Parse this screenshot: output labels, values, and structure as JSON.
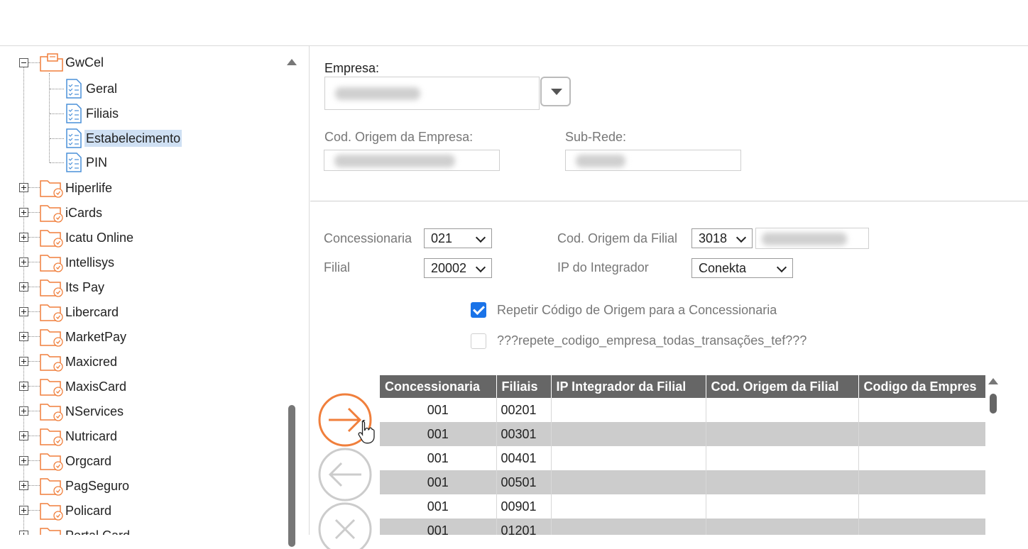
{
  "tree": {
    "items": [
      {
        "label": "GwCel",
        "type": "folder-open",
        "selected": false
      },
      {
        "label": "Geral",
        "type": "doc",
        "selected": false
      },
      {
        "label": "Filiais",
        "type": "doc",
        "selected": false
      },
      {
        "label": "Estabelecimento",
        "type": "doc",
        "selected": true
      },
      {
        "label": "PIN",
        "type": "doc",
        "selected": false
      },
      {
        "label": "Hiperlife",
        "type": "folder"
      },
      {
        "label": "iCards",
        "type": "folder"
      },
      {
        "label": "Icatu Online",
        "type": "folder"
      },
      {
        "label": "Intellisys",
        "type": "folder"
      },
      {
        "label": "Its Pay",
        "type": "folder"
      },
      {
        "label": "Libercard",
        "type": "folder"
      },
      {
        "label": "MarketPay",
        "type": "folder"
      },
      {
        "label": "Maxicred",
        "type": "folder"
      },
      {
        "label": "MaxisCard",
        "type": "folder"
      },
      {
        "label": "NServices",
        "type": "folder"
      },
      {
        "label": "Nutricard",
        "type": "folder"
      },
      {
        "label": "Orgcard",
        "type": "folder"
      },
      {
        "label": "PagSeguro",
        "type": "folder"
      },
      {
        "label": "Policard",
        "type": "folder"
      },
      {
        "label": "Portal Card",
        "type": "folder"
      }
    ]
  },
  "form": {
    "empresa_label": "Empresa:",
    "cod_origem_empresa_label": "Cod. Origem da Empresa:",
    "sub_rede_label": "Sub-Rede:",
    "concessionaria_label": "Concessionaria",
    "concessionaria_value": "021",
    "filial_label": "Filial",
    "filial_value": "20002",
    "cod_origem_filial_label": "Cod. Origem da Filial",
    "cod_origem_filial_value": "3018",
    "ip_integrador_label": "IP do Integrador",
    "ip_integrador_value": "Conekta",
    "check_repetir_label": "Repetir Código de Origem para a Concessionaria",
    "check_repetir_checked": true,
    "check_repete_tef_label": "???repete_codigo_empresa_todas_transações_tef???",
    "check_repete_tef_checked": false
  },
  "grid": {
    "columns": [
      "Concessionaria",
      "Filiais",
      "IP Integrador da Filial",
      "Cod. Origem da Filial",
      "Codigo da Empres"
    ],
    "rows": [
      [
        "001",
        "00201",
        "",
        "",
        ""
      ],
      [
        "001",
        "00301",
        "",
        "",
        ""
      ],
      [
        "001",
        "00401",
        "",
        "",
        ""
      ],
      [
        "001",
        "00501",
        "",
        "",
        ""
      ],
      [
        "001",
        "00901",
        "",
        "",
        ""
      ],
      [
        "001",
        "01201",
        "",
        "",
        ""
      ]
    ]
  },
  "buttons": {
    "add_icon": "arrow-right-icon",
    "remove_icon": "arrow-left-icon",
    "clear_icon": "close-icon"
  },
  "colors": {
    "accent_orange": "#f07f3c",
    "disabled_gray": "#cccccc",
    "header_gray": "#666666",
    "selection_blue": "#cfe0f3",
    "checkbox_blue": "#1a73e8"
  }
}
